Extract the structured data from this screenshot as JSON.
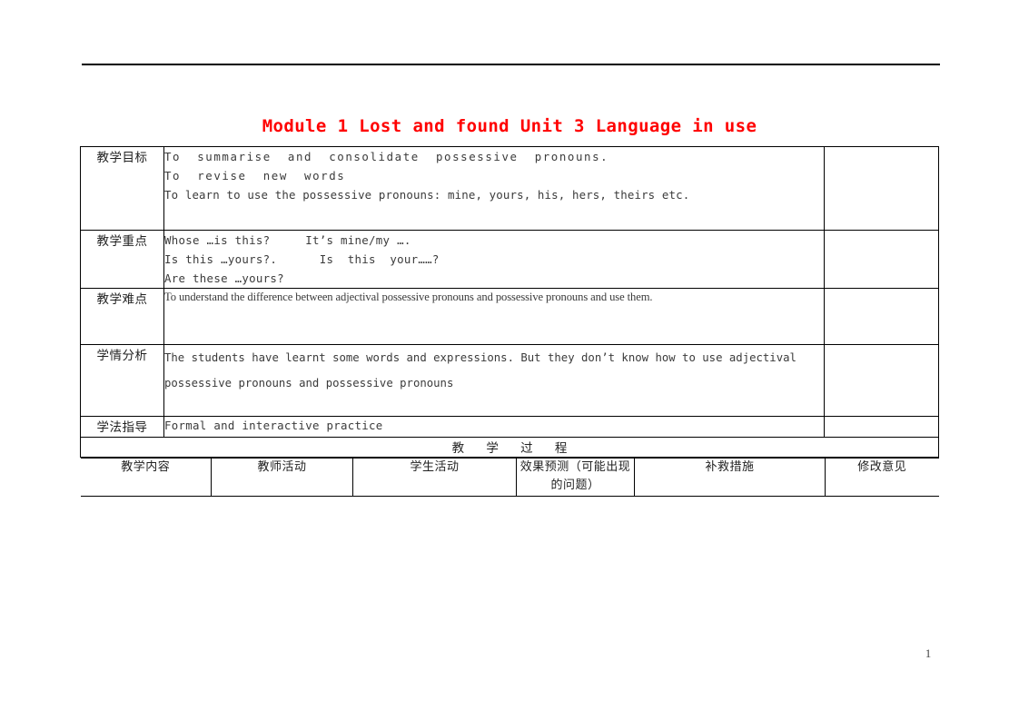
{
  "document": {
    "title": "Module 1 Lost and found Unit 3 Language in use",
    "page_number": "1"
  },
  "table": {
    "rows": [
      {
        "label": "教学目标",
        "lines": [
          "To  summarise  and  consolidate  possessive  pronouns.",
          "To  revise  new  words",
          "To learn to use the possessive pronouns: mine, yours, his, hers, theirs etc."
        ],
        "note": ""
      },
      {
        "label": "教学重点",
        "lines": [
          "Whose …is this?     It’s mine/my ….",
          "Is this …yours?.      Is  this  your……?",
          "Are these …yours?"
        ],
        "note": ""
      },
      {
        "label": "教学难点",
        "lines": [
          "To understand   the difference between adjectival possessive pronouns and possessive pronouns   and use them."
        ],
        "note": ""
      },
      {
        "label": "学情分析",
        "lines": [
          "The students have learnt some words and expressions. But they don’t know how to use adjectival possessive",
          "pronouns and possessive pronouns"
        ],
        "note": ""
      },
      {
        "label": "学法指导",
        "lines": [
          "Formal and interactive  practice"
        ],
        "note": ""
      }
    ],
    "process_banner": "教 学 过 程",
    "columns": [
      "教学内容",
      "教师活动",
      "学生活动",
      "效果预测（可能出现的问题）",
      "补救措施",
      "修改意见"
    ]
  }
}
